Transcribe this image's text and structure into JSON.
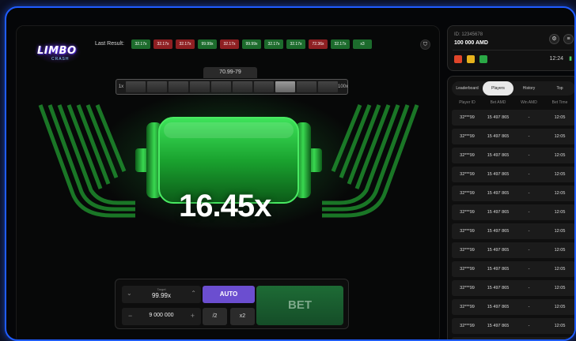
{
  "header": {
    "logo_title": "LIMBO",
    "logo_sub": "CRASH",
    "last_result_label": "Last Result:",
    "results": [
      {
        "v": "32.17x",
        "c": "g"
      },
      {
        "v": "32.17x",
        "c": "r"
      },
      {
        "v": "32.17x",
        "c": "r"
      },
      {
        "v": "99.99x",
        "c": "g"
      },
      {
        "v": "32.17x",
        "c": "r"
      },
      {
        "v": "99.99x",
        "c": "g"
      },
      {
        "v": "32.17x",
        "c": "g"
      },
      {
        "v": "32.17x",
        "c": "g"
      },
      {
        "v": "72.36x",
        "c": "r"
      },
      {
        "v": "32.17x",
        "c": "g"
      },
      {
        "v": "x3",
        "c": "g"
      }
    ]
  },
  "range": {
    "label": "70.99-79",
    "min_label": "1x",
    "max_label": "100x"
  },
  "game": {
    "multiplier": "16.45x"
  },
  "controls": {
    "target_caption": "Target",
    "target_value": "99.99x",
    "amount_value": "9 000 000",
    "auto_label": "AUTO",
    "half_label": "/2",
    "double_label": "x2",
    "bet_label": "BET"
  },
  "account": {
    "id": "ID: 12345678",
    "balance": "100 000 AMD",
    "time": "12:24"
  },
  "board": {
    "tabs": [
      "Leaderboard",
      "Players",
      "History",
      "Top"
    ],
    "active_tab": 1,
    "columns": [
      "Player ID",
      "Bet AMD",
      "Win AMD",
      "Bet Time"
    ],
    "rows": [
      [
        "32***99",
        "15 497 865",
        "-",
        "12:05"
      ],
      [
        "32***99",
        "15 497 865",
        "-",
        "12:05"
      ],
      [
        "32***99",
        "15 497 865",
        "-",
        "12:05"
      ],
      [
        "32***99",
        "15 497 865",
        "-",
        "12:05"
      ],
      [
        "32***99",
        "15 497 865",
        "-",
        "12:05"
      ],
      [
        "32***99",
        "15 497 865",
        "-",
        "12:05"
      ],
      [
        "32***99",
        "15 497 865",
        "-",
        "12:05"
      ],
      [
        "32***99",
        "15 497 865",
        "-",
        "12:05"
      ],
      [
        "32***99",
        "15 497 865",
        "-",
        "12:05"
      ],
      [
        "32***99",
        "15 497 865",
        "-",
        "12:05"
      ],
      [
        "32***99",
        "15 497 865",
        "-",
        "12:05"
      ],
      [
        "32***99",
        "15 497 865",
        "-",
        "12:05"
      ],
      [
        "32***99",
        "15 497 865",
        "-",
        "12:05"
      ]
    ]
  },
  "colors": {
    "accent": "#1f5cff",
    "green": "#22c13a",
    "purple": "#6b4ed0"
  }
}
